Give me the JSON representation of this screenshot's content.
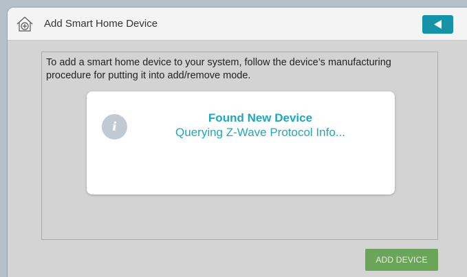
{
  "header": {
    "title": "Add Smart Home Device",
    "home_icon": "home-plus-icon",
    "back_icon": "back-arrow-icon"
  },
  "main": {
    "instructions": "To add a smart home device to your system, follow the device’s manufacturing procedure for putting it into add/remove mode."
  },
  "dialog": {
    "icon": "info-icon",
    "icon_glyph": "i",
    "title": "Found New Device",
    "status": "Querying Z-Wave Protocol Info..."
  },
  "footer": {
    "add_device_label": "ADD DEVICE"
  },
  "colors": {
    "accent": "#1594a8",
    "dialog_text": "#20a7bb",
    "add_button": "#6aa55a",
    "background": "#d4d4d4"
  }
}
